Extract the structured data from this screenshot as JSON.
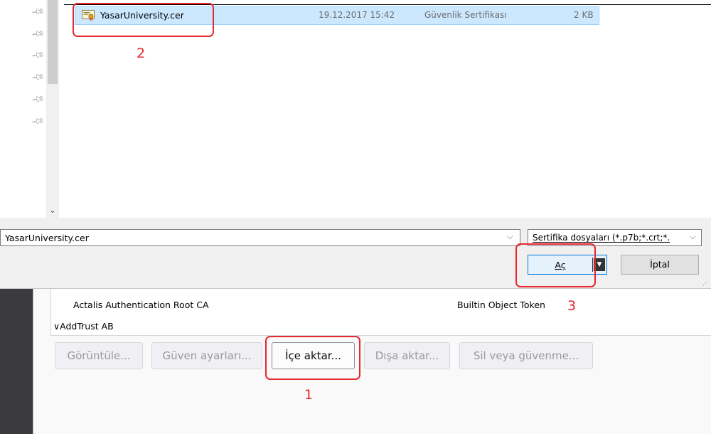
{
  "file_list": {
    "selected_file": {
      "name": "YasarUniversity.cer",
      "date": "19.12.2017 15:42",
      "type": "Güvenlik Sertifikası",
      "size": "2 KB"
    },
    "pinned_item_count": 6
  },
  "bottom_bar": {
    "filename_value": "YasarUniversity.cer",
    "file_type_filter": "Sertifika dosyaları (*.p7b;*.crt;*.",
    "open_button": "Aç",
    "cancel_button": "İptal"
  },
  "cert_manager": {
    "rows": [
      {
        "name": "Actalis Authentication Root CA",
        "token": "Builtin Object Token"
      }
    ],
    "group": "∨AddTrust AB",
    "buttons": {
      "view": "Görüntüle...",
      "trust": "Güven ayarları...",
      "import": "İçe aktar...",
      "export": "Dışa aktar...",
      "delete": "Sil veya güvenme..."
    }
  },
  "annotations": {
    "step1": "1",
    "step2": "2",
    "step3": "3",
    "color": "#e8262e"
  },
  "icons": [
    "pin-icon",
    "certificate-file-icon",
    "chevron-down-icon",
    "dropdown-arrow-icon"
  ]
}
